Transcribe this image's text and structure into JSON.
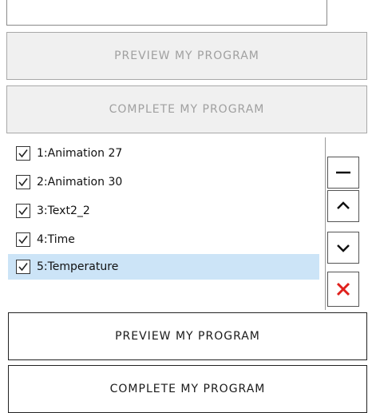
{
  "buttons": {
    "preview_disabled_label": "PREVIEW MY PROGRAM",
    "complete_disabled_label": "COMPLETE MY PROGRAM",
    "preview_label": "PREVIEW MY PROGRAM",
    "complete_label": "COMPLETE MY PROGRAM"
  },
  "playlist": {
    "items": [
      {
        "label": "1:Animation 27",
        "checked": true,
        "selected": false
      },
      {
        "label": "2:Animation 30",
        "checked": true,
        "selected": false
      },
      {
        "label": "3:Text2_2",
        "checked": true,
        "selected": false
      },
      {
        "label": "4:Time",
        "checked": true,
        "selected": false
      },
      {
        "label": "5:Temperature",
        "checked": true,
        "selected": true
      }
    ]
  },
  "side_controls": {
    "remove_icon": "minus-icon",
    "up_icon": "chevron-up-icon",
    "down_icon": "chevron-down-icon",
    "delete_icon": "close-icon",
    "delete_color": "#e0201c"
  },
  "colors": {
    "selected_row": "#cce4f7",
    "disabled_bg": "#f0f0f0",
    "disabled_text": "#a0a0a0"
  }
}
